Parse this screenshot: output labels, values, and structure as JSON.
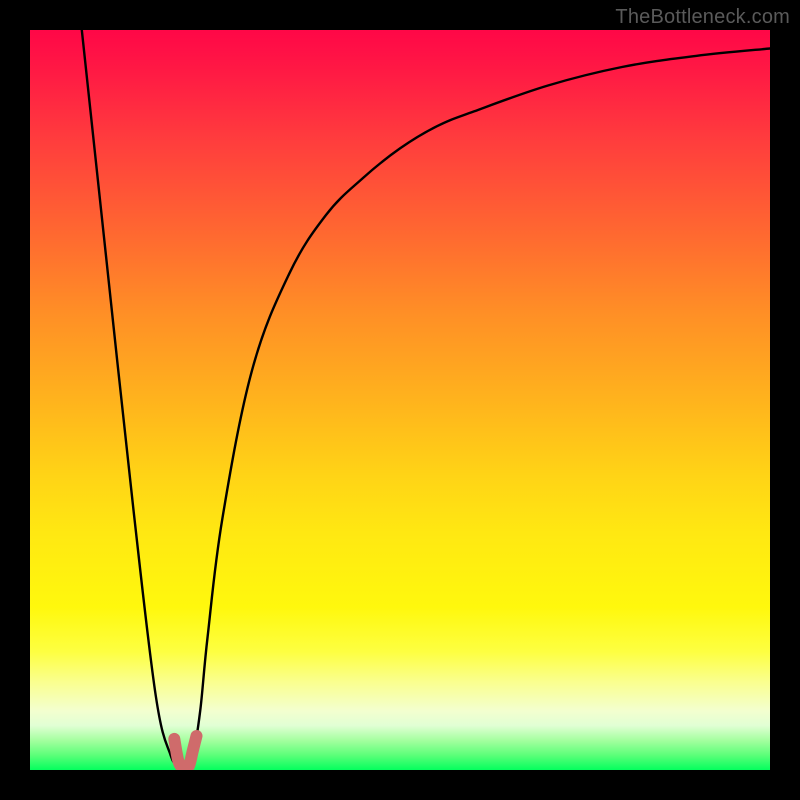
{
  "watermark": "TheBottleneck.com",
  "chart_data": {
    "type": "line",
    "title": "",
    "xlabel": "",
    "ylabel": "",
    "xlim": [
      0,
      100
    ],
    "ylim": [
      0,
      100
    ],
    "grid": false,
    "legend": false,
    "series": [
      {
        "name": "bottleneck-curve",
        "color": "#000000",
        "x": [
          7,
          10,
          14,
          17,
          19,
          20,
          21,
          22,
          23,
          24,
          26,
          30,
          35,
          40,
          45,
          50,
          55,
          60,
          70,
          80,
          90,
          100
        ],
        "y": [
          100,
          72,
          35,
          10,
          2,
          1,
          1,
          2,
          8,
          18,
          34,
          54,
          67,
          75,
          80,
          84,
          87,
          89,
          92.5,
          95,
          96.5,
          97.5
        ]
      },
      {
        "name": "marker-band",
        "color": "#cf6b6b",
        "x": [
          19.5,
          20,
          20.5,
          21,
          21.5,
          22,
          22.5
        ],
        "y": [
          4.2,
          1.4,
          0.4,
          0.4,
          0.6,
          2.6,
          4.6
        ]
      }
    ],
    "background_gradient_stops": [
      {
        "pos": 0.0,
        "color": "#ff0747"
      },
      {
        "pos": 0.15,
        "color": "#ff3d3d"
      },
      {
        "pos": 0.38,
        "color": "#ff8e26"
      },
      {
        "pos": 0.6,
        "color": "#ffd316"
      },
      {
        "pos": 0.78,
        "color": "#fff80d"
      },
      {
        "pos": 0.92,
        "color": "#f3ffcf"
      },
      {
        "pos": 1.0,
        "color": "#04ff5e"
      }
    ],
    "optimal_x": 21
  }
}
